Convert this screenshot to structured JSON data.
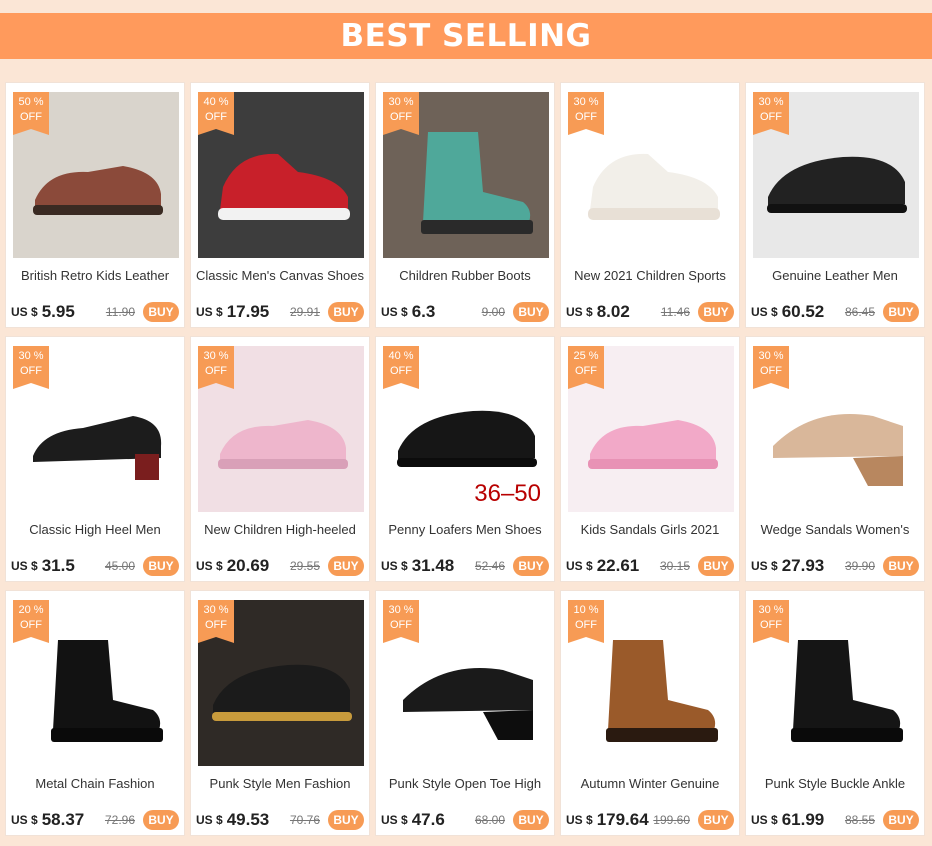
{
  "banner": {
    "title": "BEST SELLING"
  },
  "currency_label": "US $",
  "buy_label": "BUY",
  "off_label": "OFF",
  "products": [
    {
      "discount": "50 %",
      "name": "British Retro Kids Leather",
      "price": "5.95",
      "old_price": "11.90",
      "icon": "kids-leather-shoes-photo"
    },
    {
      "discount": "40 %",
      "name": "Classic Men's Canvas Shoes",
      "price": "17.95",
      "old_price": "29.91",
      "icon": "red-canvas-shoe-photo"
    },
    {
      "discount": "30 %",
      "name": "Children Rubber Boots",
      "price": "6.3",
      "old_price": "9.00",
      "icon": "floral-boots-photo"
    },
    {
      "discount": "30 %",
      "name": "New 2021 Children Sports",
      "price": "8.02",
      "old_price": "11.46",
      "icon": "sports-sneakers-photo"
    },
    {
      "discount": "30 %",
      "name": "Genuine Leather Men",
      "price": "60.52",
      "old_price": "86.45",
      "icon": "leather-loafers-photo"
    },
    {
      "discount": "30 %",
      "name": "Classic High Heel Men",
      "price": "31.5",
      "old_price": "45.00",
      "icon": "high-heel-men-shoe-photo"
    },
    {
      "discount": "30 %",
      "name": "New Children High-heeled",
      "price": "20.69",
      "old_price": "29.55",
      "icon": "pink-glitter-shoes-photo"
    },
    {
      "discount": "40 %",
      "name": "Penny Loafers Men Shoes",
      "price": "31.48",
      "old_price": "52.46",
      "icon": "penny-loafer-photo",
      "extra_text": "36–50"
    },
    {
      "discount": "25 %",
      "name": "Kids Sandals Girls 2021",
      "price": "22.61",
      "old_price": "30.15",
      "icon": "pink-sandals-photo"
    },
    {
      "discount": "30 %",
      "name": "Wedge Sandals Women's",
      "price": "27.93",
      "old_price": "39.90",
      "icon": "wedge-sandal-photo"
    },
    {
      "discount": "20 %",
      "name": "Metal Chain Fashion",
      "price": "58.37",
      "old_price": "72.96",
      "icon": "chain-boot-photo"
    },
    {
      "discount": "30 %",
      "name": "Punk Style Men Fashion",
      "price": "49.53",
      "old_price": "70.76",
      "icon": "studded-loafer-photo"
    },
    {
      "discount": "30 %",
      "name": "Punk Style Open Toe High",
      "price": "47.6",
      "old_price": "68.00",
      "icon": "platform-sandal-photo"
    },
    {
      "discount": "10 %",
      "name": "Autumn Winter Genuine",
      "price": "179.64",
      "old_price": "199.60",
      "icon": "brown-ankle-boot-photo"
    },
    {
      "discount": "30 %",
      "name": "Punk Style Buckle Ankle",
      "price": "61.99",
      "old_price": "88.55",
      "icon": "buckle-ankle-boot-photo"
    }
  ]
}
